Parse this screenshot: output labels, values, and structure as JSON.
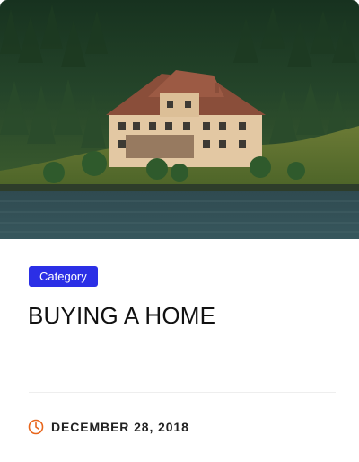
{
  "card": {
    "category_label": "Category",
    "title": "BUYING A HOME",
    "date": "DECEMBER 28, 2018",
    "image_icon": "lake-house-photo",
    "date_icon": "clock-icon"
  },
  "colors": {
    "badge_bg": "#2b2fe6",
    "badge_text": "#ffffff",
    "title_text": "#111111",
    "clock_icon": "#e8661c",
    "divider": "#eeeeee"
  }
}
